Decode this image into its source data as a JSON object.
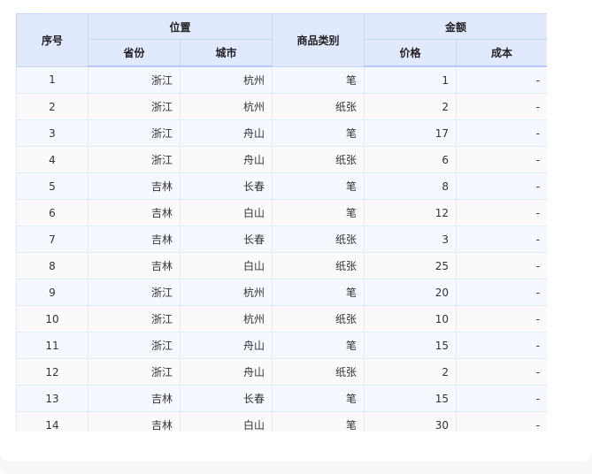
{
  "table": {
    "headers": {
      "index": "序号",
      "location": "位置",
      "province": "省份",
      "city": "城市",
      "category": "商品类别",
      "amount": "金额",
      "price": "价格",
      "cost": "成本"
    },
    "rows": [
      {
        "index": "1",
        "province": "浙江",
        "city": "杭州",
        "category": "笔",
        "price": "1",
        "cost": "-"
      },
      {
        "index": "2",
        "province": "浙江",
        "city": "杭州",
        "category": "纸张",
        "price": "2",
        "cost": "-"
      },
      {
        "index": "3",
        "province": "浙江",
        "city": "舟山",
        "category": "笔",
        "price": "17",
        "cost": "-"
      },
      {
        "index": "4",
        "province": "浙江",
        "city": "舟山",
        "category": "纸张",
        "price": "6",
        "cost": "-"
      },
      {
        "index": "5",
        "province": "吉林",
        "city": "长春",
        "category": "笔",
        "price": "8",
        "cost": "-"
      },
      {
        "index": "6",
        "province": "吉林",
        "city": "白山",
        "category": "笔",
        "price": "12",
        "cost": "-"
      },
      {
        "index": "7",
        "province": "吉林",
        "city": "长春",
        "category": "纸张",
        "price": "3",
        "cost": "-"
      },
      {
        "index": "8",
        "province": "吉林",
        "city": "白山",
        "category": "纸张",
        "price": "25",
        "cost": "-"
      },
      {
        "index": "9",
        "province": "浙江",
        "city": "杭州",
        "category": "笔",
        "price": "20",
        "cost": "-"
      },
      {
        "index": "10",
        "province": "浙江",
        "city": "杭州",
        "category": "纸张",
        "price": "10",
        "cost": "-"
      },
      {
        "index": "11",
        "province": "浙江",
        "city": "舟山",
        "category": "笔",
        "price": "15",
        "cost": "-"
      },
      {
        "index": "12",
        "province": "浙江",
        "city": "舟山",
        "category": "纸张",
        "price": "2",
        "cost": "-"
      },
      {
        "index": "13",
        "province": "吉林",
        "city": "长春",
        "category": "笔",
        "price": "15",
        "cost": "-"
      },
      {
        "index": "14",
        "province": "吉林",
        "city": "白山",
        "category": "笔",
        "price": "30",
        "cost": "-"
      }
    ]
  }
}
